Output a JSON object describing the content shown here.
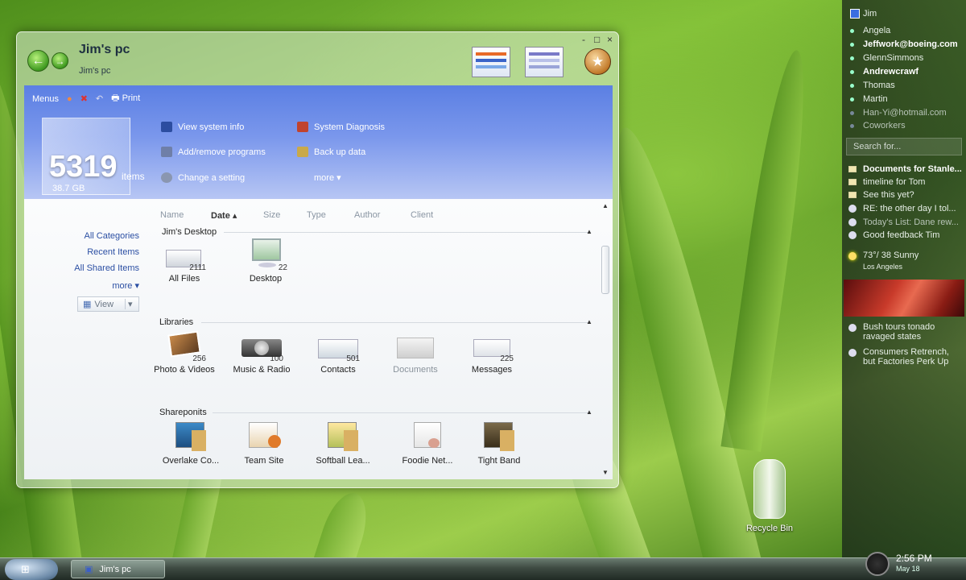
{
  "window": {
    "title": "Jim's pc",
    "subtitle": "Jim's pc",
    "minimize": "-",
    "maximize": "□",
    "close": "×"
  },
  "menubar": {
    "menus": "Menus",
    "print": "Print"
  },
  "summary": {
    "count": "5319",
    "unit": "items",
    "size": "38.7 GB"
  },
  "tasks": [
    {
      "label": "View system info",
      "color": "#2c4da0"
    },
    {
      "label": "Add/remove programs",
      "color": "#6f7fa8"
    },
    {
      "label": "Change a setting",
      "color": "#8a96b0"
    },
    {
      "label": "System Diagnosis",
      "color": "#c0432e"
    },
    {
      "label": "Back up data",
      "color": "#c9a94a"
    },
    {
      "label": "more ▾",
      "color": ""
    }
  ],
  "columns": [
    "Name",
    "Date",
    "Size",
    "Type",
    "Author",
    "Client"
  ],
  "date_sort_arrow": "▴",
  "leftnav": {
    "all_categories": "All Categories",
    "recent_items": "Recent Items",
    "all_shared_items": "All Shared Items",
    "more": "more ▾",
    "view": "View"
  },
  "groups": {
    "desktop": {
      "title": "Jim's Desktop",
      "items": [
        {
          "label": "All Files",
          "count": "2111"
        },
        {
          "label": "Desktop",
          "count": "22"
        }
      ]
    },
    "libraries": {
      "title": "Libraries",
      "items": [
        {
          "label": "Photo & Videos",
          "count": "256"
        },
        {
          "label": "Music & Radio",
          "count": "100"
        },
        {
          "label": "Contacts",
          "count": "501"
        },
        {
          "label": "Documents",
          "count": ""
        },
        {
          "label": "Messages",
          "count": "225"
        }
      ]
    },
    "shareponits": {
      "title": "Shareponits",
      "items": [
        {
          "label": "Overlake Co..."
        },
        {
          "label": "Team Site"
        },
        {
          "label": "Softball Lea..."
        },
        {
          "label": "Foodie Net..."
        },
        {
          "label": "Tight Band"
        }
      ]
    }
  },
  "sidebar": {
    "user": "Jim",
    "contacts": [
      {
        "name": "Angela",
        "bold": false
      },
      {
        "name": "Jeffwork@boeing.com",
        "bold": true
      },
      {
        "name": "GlennSimmons",
        "bold": false
      },
      {
        "name": "Andrewcrawf",
        "bold": true
      },
      {
        "name": "Thomas",
        "bold": false
      },
      {
        "name": "Martin",
        "bold": false
      },
      {
        "name": "Han-Yi@hotmail.com",
        "bold": false
      },
      {
        "name": "Coworkers",
        "bold": false
      }
    ],
    "search_placeholder": "Search for...",
    "messages": [
      "Documents for Stanle...",
      "timeline for Tom",
      "See this yet?",
      "RE: the other day I tol...",
      "Today's List: Dane rew...",
      "Good feedback Tim"
    ],
    "weather": {
      "temp": "73°/ 38 Sunny",
      "city": "Los Angeles"
    },
    "news": [
      {
        "line1": "Bush tours tonado",
        "line2": "ravaged states"
      },
      {
        "line1": "Consumers Retrench,",
        "line2": "but Factories Perk Up"
      }
    ]
  },
  "desktop": {
    "recycle_bin": "Recycle Bin"
  },
  "taskbar": {
    "task_label": "Jim's pc",
    "time": "2:56 PM",
    "date": "May 18"
  }
}
